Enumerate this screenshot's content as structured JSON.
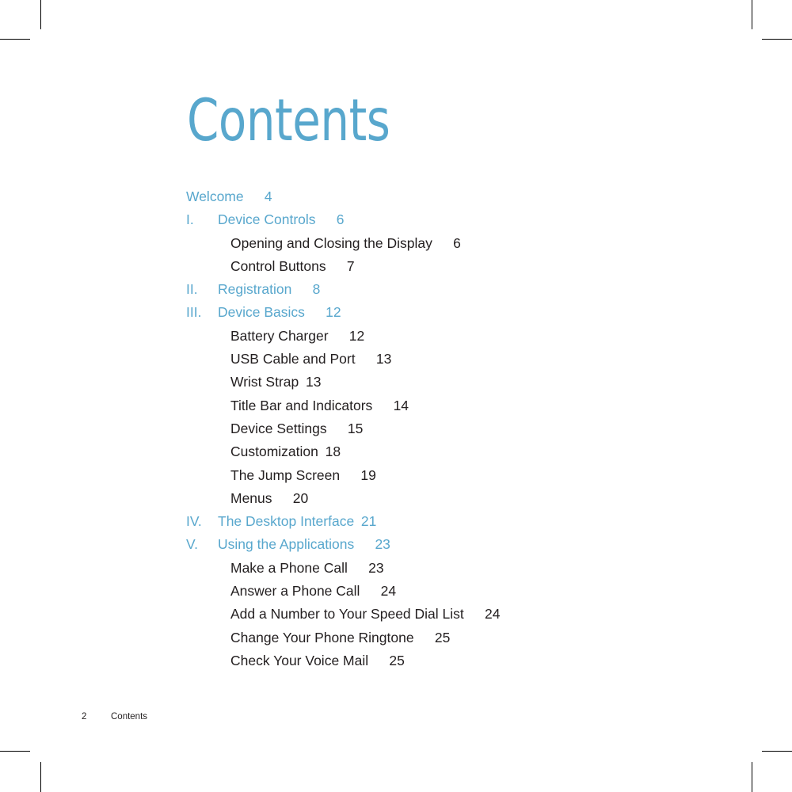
{
  "page": {
    "title": "Contents",
    "accent_color": "#58a7cd",
    "body_color": "#231f20",
    "background": "#ffffff"
  },
  "toc": {
    "entries": [
      {
        "level": "plain",
        "numeral": "",
        "title": "Welcome",
        "page": "4",
        "gap": "wide"
      },
      {
        "level": "top",
        "numeral": "I.",
        "title": "Device Controls",
        "page": "6",
        "gap": "wide"
      },
      {
        "level": "sub",
        "numeral": "",
        "title": "Opening and Closing the Display",
        "page": "6",
        "gap": "wide"
      },
      {
        "level": "sub",
        "numeral": "",
        "title": "Control Buttons",
        "page": "7",
        "gap": "wide"
      },
      {
        "level": "top",
        "numeral": "II.",
        "title": "Registration",
        "page": "8",
        "gap": "wide"
      },
      {
        "level": "top",
        "numeral": "III.",
        "title": "Device Basics",
        "page": "12",
        "gap": "wide"
      },
      {
        "level": "sub",
        "numeral": "",
        "title": "Battery Charger",
        "page": "12",
        "gap": "wide"
      },
      {
        "level": "sub",
        "numeral": "",
        "title": "USB Cable and Port",
        "page": "13",
        "gap": "wide"
      },
      {
        "level": "sub",
        "numeral": "",
        "title": "Wrist Strap",
        "page": "13",
        "gap": "narrow"
      },
      {
        "level": "sub",
        "numeral": "",
        "title": "Title Bar and Indicators",
        "page": "14",
        "gap": "wide"
      },
      {
        "level": "sub",
        "numeral": "",
        "title": "Device Settings",
        "page": "15",
        "gap": "wide"
      },
      {
        "level": "sub",
        "numeral": "",
        "title": "Customization",
        "page": "18",
        "gap": "narrow"
      },
      {
        "level": "sub",
        "numeral": "",
        "title": "The Jump Screen",
        "page": "19",
        "gap": "wide"
      },
      {
        "level": "sub",
        "numeral": "",
        "title": "Menus",
        "page": "20",
        "gap": "wide"
      },
      {
        "level": "top",
        "numeral": "IV.",
        "title": "The Desktop Interface",
        "page": "21",
        "gap": "narrow"
      },
      {
        "level": "top",
        "numeral": "V.",
        "title": "Using the Applications",
        "page": "23",
        "gap": "wide"
      },
      {
        "level": "sub",
        "numeral": "",
        "title": "Make a Phone Call",
        "page": "23",
        "gap": "wide"
      },
      {
        "level": "sub",
        "numeral": "",
        "title": "Answer a Phone Call",
        "page": "24",
        "gap": "wide"
      },
      {
        "level": "sub",
        "numeral": "",
        "title": "Add a Number to Your Speed Dial List",
        "page": "24",
        "gap": "wide"
      },
      {
        "level": "sub",
        "numeral": "",
        "title": "Change Your Phone Ringtone",
        "page": "25",
        "gap": "wide"
      },
      {
        "level": "sub",
        "numeral": "",
        "title": "Check Your Voice Mail",
        "page": "25",
        "gap": "wide"
      }
    ]
  },
  "footer": {
    "page_number": "2",
    "label": "Contents"
  },
  "crop_marks": {
    "present": true,
    "count": 8,
    "color": "#000000"
  }
}
